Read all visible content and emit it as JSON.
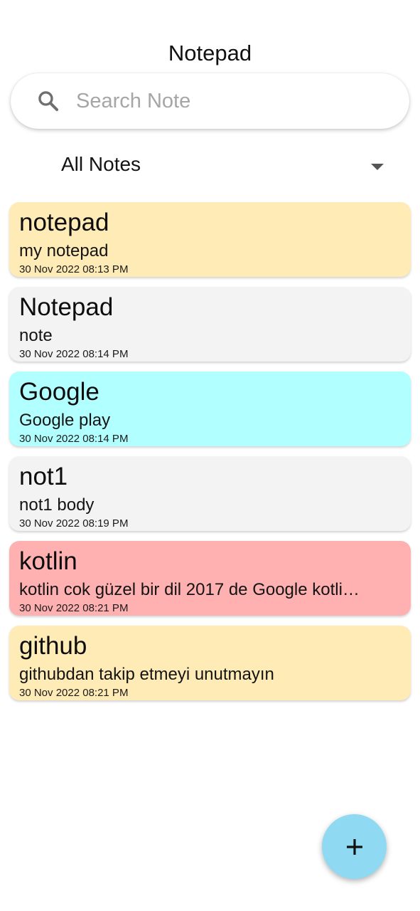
{
  "header": {
    "title": "Notepad"
  },
  "search": {
    "placeholder": "Search Note",
    "value": "",
    "icon": "search-icon"
  },
  "filter": {
    "selected": "All Notes",
    "icon": "dropdown-arrow-icon"
  },
  "notes": [
    {
      "title": "notepad",
      "body": "my notepad",
      "date": "30 Nov 2022 08:13 PM",
      "color": "#ffebb5"
    },
    {
      "title": "Notepad",
      "body": "note",
      "date": "30 Nov 2022 08:14 PM",
      "color": "#f3f3f3"
    },
    {
      "title": "Google",
      "body": "Google play",
      "date": "30 Nov 2022 08:14 PM",
      "color": "#b2ffff"
    },
    {
      "title": "not1",
      "body": "not1 body",
      "date": "30 Nov 2022 08:19 PM",
      "color": "#f3f3f3"
    },
    {
      "title": "kotlin",
      "body": "kotlin cok güzel bir dil 2017 de Google kotli…",
      "date": "30 Nov 2022 08:21 PM",
      "color": "#ffb1b2"
    },
    {
      "title": "github",
      "body": "githubdan takip etmeyi unutmayın",
      "date": "30 Nov 2022 08:21 PM",
      "color": "#ffebb5"
    }
  ],
  "fab": {
    "icon": "plus-icon",
    "color": "#8fdaf2"
  }
}
